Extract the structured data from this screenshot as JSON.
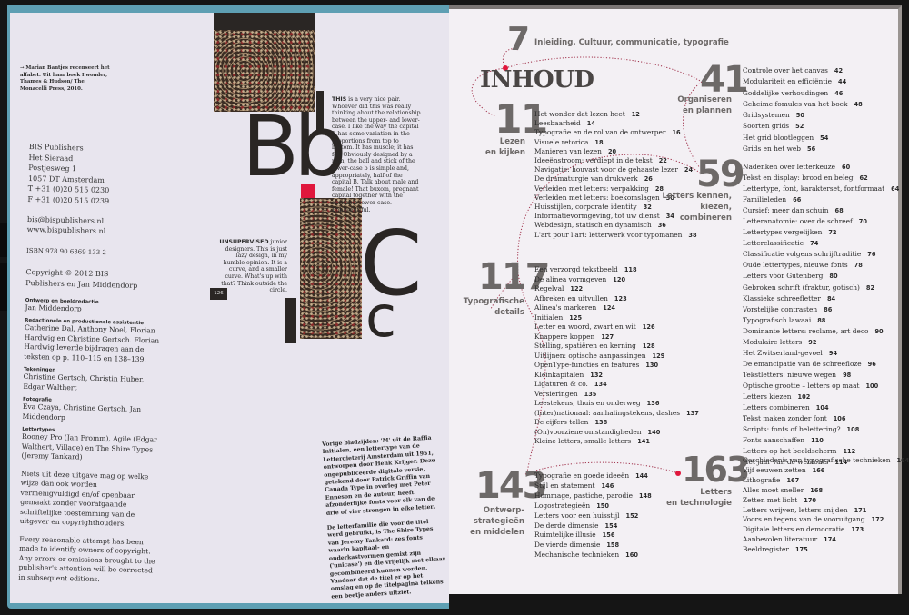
{
  "colors": {
    "accent_red": "#e0173c",
    "number_gray": "#6d6968",
    "cover_teal": "#5e9fb3"
  },
  "left_page": {
    "caption": "→ Marian Bantjes recenseert het alfabet. Uit haar boek I wonder, Thames & Hudson/ The Monacelli Press, 2010.",
    "address": [
      "BIS Publishers",
      "Het Sieraad",
      "Postjesweg 1",
      "1057 DT Amsterdam",
      "T +31 (0)20 515 0230",
      "F +31 (0)20 515 0239"
    ],
    "email": "bis@bispublishers.nl",
    "website": "www.bispublishers.nl",
    "isbn": "ISBN 978 90 6369 133 2",
    "copyright": "Copyright © 2012 BIS Publishers en Jan Middendorp",
    "credits": [
      {
        "label": "Ontwerp en beeldredactie",
        "text": "Jan Middendorp"
      },
      {
        "label": "Redactionele en productionele assistentie",
        "text": "Catherine Dal, Anthony Noel, Florian Hardwig en Christine Gertsch. Florian Hardwig leverde bijdragen aan de teksten op p. 110–115 en 138–139."
      },
      {
        "label": "Tekeningen",
        "text": "Christine Gertsch, Christin Huber, Edgar Walthert"
      },
      {
        "label": "Fotografie",
        "text": "Eva Czaya, Christine Gertsch, Jan Middendorp"
      },
      {
        "label": "Lettertypes",
        "text": "Rooney Pro (Jan Fromm), Agile (Edgar Walthert, Village) en The Shire Types (Jeremy Tankard)"
      }
    ],
    "rights_nl": "Niets uit deze uitgave mag op welke wijze dan ook worden vermenigvuldigd en/of openbaar gemaakt zonder voorafgaande schriftelijke toestemming van de uitgever en copyrighthouders.",
    "rights_en": "Every reasonable attempt has been made to identify owners of copyright. Any errors or omissions brought to the publisher's attention will be corrected in subsequent editions.",
    "artwork": {
      "letters_b": "Bb",
      "letter_c_upper": "C",
      "letter_c_lower": "c",
      "text_b_lead": "THIS",
      "text_b": " is a very nice pair. Whoever did this was really thinking about the relationship between the upper- and lower-case. I like the way the capital B has some variation in the proportions from top to bottom. It has muscle; it has fat. Obviously designed by a man, the ball and stick of the lower-case b is simple and, appropriately, half of the capital B. Talk about male and female! That buxom, pregnant capital together with the excitable lower-case. Bbbbeautiful.",
      "text_c_lead": "UNSUPERVISED",
      "text_c": " junior designers. This is just lazy design, in my humble opinion. It is a curve, and a smaller curve. What's up with that? Think outside the circle.",
      "page_number": "126"
    },
    "note_1": "Vorige bladzijden: 'M' uit de Raffia Initialen, een lettertype van de Lettergieterij Amsterdam uit 1951, ontworpen door Henk Krijger. Deze ongepubliceerde digitale versie, getekend door Patrick Griffin van Canada Type in overleg met Peter Enneson en de auteur, heeft afzonderlijke fonts voor elk van de drie of vier strengen in elke letter.",
    "note_2": "De letterfamilie die voor de titel werd gebruikt, is The Shire Types van Jeremy Tankard: zes fonts waarin kapitaal- en onderkastvormen gemixt zijn ('unicase') en die vrijelijk met elkaar gecombineerd kunnen worden. Vandaar dat de titel er op het omslag en op de titelpagina telkens een beetje anders uitziet."
  },
  "right_page": {
    "title": "INHOUD",
    "intro": {
      "number": "7",
      "title": "Inleiding. Cultuur, communicatie, typografie"
    },
    "sections": [
      {
        "number": "11",
        "label": [
          "Lezen",
          "en kijken"
        ],
        "items": [
          [
            "Het wonder dat lezen heet",
            "12"
          ],
          [
            "Leesbaarheid",
            "14"
          ],
          [
            "Typografie en de rol van de ontwerper",
            "16"
          ],
          [
            "Visuele retorica",
            "18"
          ],
          [
            "Manieren van lezen",
            "20"
          ],
          [
            "Ideeënstroom: verdiept in de tekst",
            "22"
          ],
          [
            "Navigatie: houvast voor de gehaaste lezer",
            "24"
          ],
          [
            "De dramaturgie van drukwerk",
            "26"
          ],
          [
            "Verleiden met letters: verpakking",
            "28"
          ],
          [
            "Verleiden met letters: boekomslagen",
            "30"
          ],
          [
            "Huisstijlen, corporate identity",
            "32"
          ],
          [
            "Informatievormgeving, tot uw dienst",
            "34"
          ],
          [
            "Webdesign, statisch en dynamisch",
            "36"
          ],
          [
            "L'art pour l'art: letterwerk voor typomanen",
            "38"
          ]
        ]
      },
      {
        "number": "41",
        "label": [
          "Organiseren",
          "en plannen"
        ],
        "items": [
          [
            "Controle over het canvas",
            "42"
          ],
          [
            "Modulariteit en efficiëntie",
            "44"
          ],
          [
            "Goddelijke verhoudingen",
            "46"
          ],
          [
            "Geheime fomules van het boek",
            "48"
          ],
          [
            "Gridsystemen",
            "50"
          ],
          [
            "Soorten grids",
            "52"
          ],
          [
            "Het grid blootleggen",
            "54"
          ],
          [
            "Grids en het web",
            "56"
          ]
        ]
      },
      {
        "number": "59",
        "label": [
          "Letters kennen,",
          "kiezen,",
          "combineren"
        ],
        "items": [
          [
            "Nadenken over letterkeuze",
            "60"
          ],
          [
            "Tekst en display: brood en beleg",
            "62"
          ],
          [
            "Lettertype, font, karakterset, fontformaat",
            "64"
          ],
          [
            "Familieleden",
            "66"
          ],
          [
            "Cursief: meer dan schuin",
            "68"
          ],
          [
            "Letteranatomie: over de schreef",
            "70"
          ],
          [
            "Lettertypes vergelijken",
            "72"
          ],
          [
            "Letterclassificatie",
            "74"
          ],
          [
            "Classificatie volgens schrijftraditie",
            "76"
          ],
          [
            "Oude lettertypes, nieuwe fonts",
            "78"
          ],
          [
            "Letters vóór Gutenberg",
            "80"
          ],
          [
            "Gebroken schrift (fraktur, gotisch)",
            "82"
          ],
          [
            "Klassieke schreefletter",
            "84"
          ],
          [
            "Vorstelijke contrasten",
            "86"
          ],
          [
            "Typografisch lawaai",
            "88"
          ],
          [
            "Dominante letters: reclame, art deco",
            "90"
          ],
          [
            "Modulaire letters",
            "92"
          ],
          [
            "Het Zwitserland-gevoel",
            "94"
          ],
          [
            "De emancipatie van de schreefloze",
            "96"
          ],
          [
            "Tekstletters: nieuwe wegen",
            "98"
          ],
          [
            "Optische grootte – letters op maat",
            "100"
          ],
          [
            "Letters kiezen",
            "102"
          ],
          [
            "Letters combineren",
            "104"
          ],
          [
            "Tekst maken zonder font",
            "106"
          ],
          [
            "Scripts: fonts of belettering?",
            "108"
          ],
          [
            "Fonts aanschaffen",
            "110"
          ],
          [
            "Letters op het beeldscherm",
            "112"
          ],
          [
            "Het jaar van de webfonts",
            "114"
          ]
        ]
      },
      {
        "number": "117",
        "label": [
          "Typografische",
          "details"
        ],
        "items": [
          [
            "Een verzorgd tekstbeeld",
            "118"
          ],
          [
            "De alinea vormgeven",
            "120"
          ],
          [
            "Regelval",
            "122"
          ],
          [
            "Afbreken en uitvullen",
            "123"
          ],
          [
            "Alinea's markeren",
            "124"
          ],
          [
            "Initialen",
            "125"
          ],
          [
            "Letter en woord, zwart en wit",
            "126"
          ],
          [
            "Knappere koppen",
            "127"
          ],
          [
            "Stelling, spatiëren en kerning",
            "128"
          ],
          [
            "Uitlijnen: optische aanpassingen",
            "129"
          ],
          [
            "OpenType-functies en features",
            "130"
          ],
          [
            "Kleinkapitalen",
            "132"
          ],
          [
            "Ligaturen & co.",
            "134"
          ],
          [
            "Versieringen",
            "135"
          ],
          [
            "Leestekens, thuis en onderweg",
            "136"
          ],
          [
            "(Inter)nationaal: aanhalingstekens, dashes",
            "137"
          ],
          [
            "De cijfers tellen",
            "138"
          ],
          [
            "(On)voorziene omstandigheden",
            "140"
          ],
          [
            "Kleine letters, smalle letters",
            "141"
          ]
        ]
      },
      {
        "number": "143",
        "label": [
          "Ontwerp-",
          "strategieën",
          "en middelen"
        ],
        "items": [
          [
            "Typografie en goede ideeën",
            "144"
          ],
          [
            "Stijl en statement",
            "146"
          ],
          [
            "Hommage, pastiche, parodie",
            "148"
          ],
          [
            "Logostrategieën",
            "150"
          ],
          [
            "Letters voor een huisstijl",
            "152"
          ],
          [
            "De derde dimensie",
            "154"
          ],
          [
            "Ruimtelijke illusie",
            "156"
          ],
          [
            "De vierde dimensie",
            "158"
          ],
          [
            "Mechanische technieken",
            "160"
          ]
        ]
      },
      {
        "number": "163",
        "label": [
          "Letters",
          "en technologie"
        ],
        "items": [
          [
            "Geschiedenis van typografische technieken",
            "164"
          ],
          [
            "Vijf eeuwen zetten",
            "166"
          ],
          [
            "Lithografie",
            "167"
          ],
          [
            "Alles moet sneller",
            "168"
          ],
          [
            "Zetten met licht",
            "170"
          ],
          [
            "Letters wrijven, letters snijden",
            "171"
          ],
          [
            "Voors en tegens van de vooruitgang",
            "172"
          ],
          [
            "Digitale letters en democratie",
            "173"
          ],
          [
            "Aanbevolen literatuur",
            "174"
          ],
          [
            "Beeldregister",
            "175"
          ]
        ]
      }
    ]
  }
}
